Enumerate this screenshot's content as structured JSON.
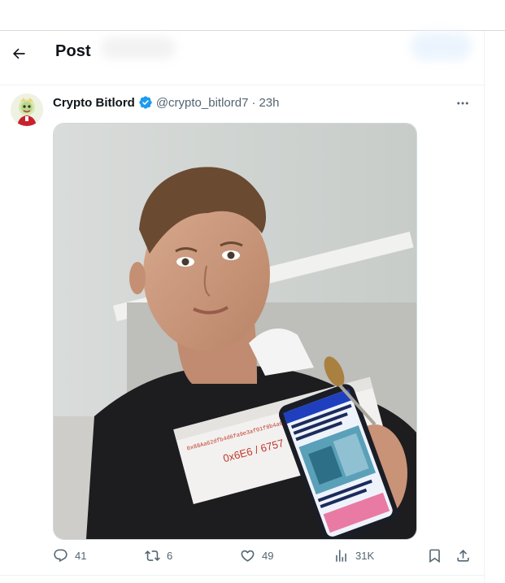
{
  "header": {
    "title": "Post"
  },
  "post": {
    "author_name": "Crypto Bitlord",
    "handle": "@crypto_bitlord7",
    "separator": "·",
    "time": "23h",
    "image": {
      "box_text_1": "0x88Aa62dfb4d6fa9e3af01f8b4a6d9f0917e4a0757",
      "box_text_2": "0x6E6 / 6757"
    }
  },
  "actions": {
    "replies": "41",
    "reposts": "6",
    "likes": "49",
    "views": "31K"
  },
  "colors": {
    "verified": "#1d9bf0",
    "text": "#0f1419",
    "muted": "#536471",
    "border": "#eff3f4"
  },
  "icons": [
    "back-arrow-icon",
    "verified-badge-icon",
    "more-icon",
    "reply-icon",
    "repost-icon",
    "like-icon",
    "views-icon",
    "bookmark-icon",
    "share-icon"
  ]
}
